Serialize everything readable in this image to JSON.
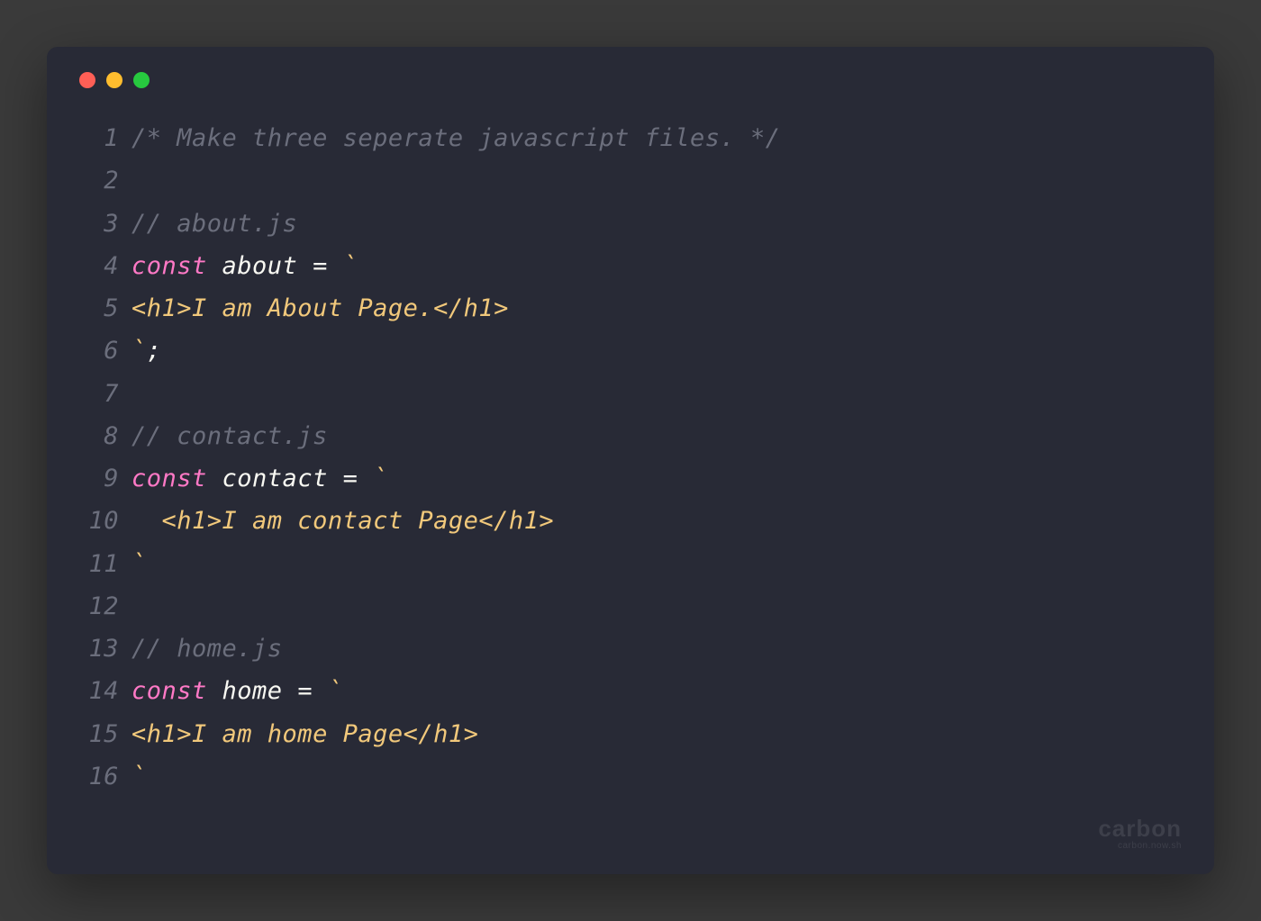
{
  "window": {
    "controls": {
      "red": "#ff5f56",
      "yellow": "#ffbd2e",
      "green": "#27c93f"
    }
  },
  "code": {
    "lines": [
      {
        "num": "1",
        "tokens": [
          {
            "cls": "tok-comment",
            "text": "/* Make three seperate javascript files. */"
          }
        ]
      },
      {
        "num": "2",
        "tokens": []
      },
      {
        "num": "3",
        "tokens": [
          {
            "cls": "tok-comment",
            "text": "// about.js"
          }
        ]
      },
      {
        "num": "4",
        "tokens": [
          {
            "cls": "tok-keyword",
            "text": "const"
          },
          {
            "cls": "tok-ident",
            "text": " about "
          },
          {
            "cls": "tok-op",
            "text": "="
          },
          {
            "cls": "tok-string",
            "text": " `"
          }
        ]
      },
      {
        "num": "5",
        "tokens": [
          {
            "cls": "tok-string",
            "text": "<h1>I am About Page.</h1>"
          }
        ]
      },
      {
        "num": "6",
        "tokens": [
          {
            "cls": "tok-string",
            "text": "`"
          },
          {
            "cls": "tok-op",
            "text": ";"
          }
        ]
      },
      {
        "num": "7",
        "tokens": []
      },
      {
        "num": "8",
        "tokens": [
          {
            "cls": "tok-comment",
            "text": "// contact.js"
          }
        ]
      },
      {
        "num": "9",
        "tokens": [
          {
            "cls": "tok-keyword",
            "text": "const"
          },
          {
            "cls": "tok-ident",
            "text": " contact "
          },
          {
            "cls": "tok-op",
            "text": "="
          },
          {
            "cls": "tok-string",
            "text": " `"
          }
        ]
      },
      {
        "num": "10",
        "tokens": [
          {
            "cls": "tok-string",
            "text": "  <h1>I am contact Page</h1>"
          }
        ]
      },
      {
        "num": "11",
        "tokens": [
          {
            "cls": "tok-string",
            "text": "`"
          }
        ]
      },
      {
        "num": "12",
        "tokens": []
      },
      {
        "num": "13",
        "tokens": [
          {
            "cls": "tok-comment",
            "text": "// home.js"
          }
        ]
      },
      {
        "num": "14",
        "tokens": [
          {
            "cls": "tok-keyword",
            "text": "const"
          },
          {
            "cls": "tok-ident",
            "text": " home "
          },
          {
            "cls": "tok-op",
            "text": "="
          },
          {
            "cls": "tok-string",
            "text": " `"
          }
        ]
      },
      {
        "num": "15",
        "tokens": [
          {
            "cls": "tok-string",
            "text": "<h1>I am home Page</h1>"
          }
        ]
      },
      {
        "num": "16",
        "tokens": [
          {
            "cls": "tok-string",
            "text": "`"
          }
        ]
      }
    ]
  },
  "watermark": {
    "main": "carbon",
    "sub": "carbon.now.sh"
  }
}
